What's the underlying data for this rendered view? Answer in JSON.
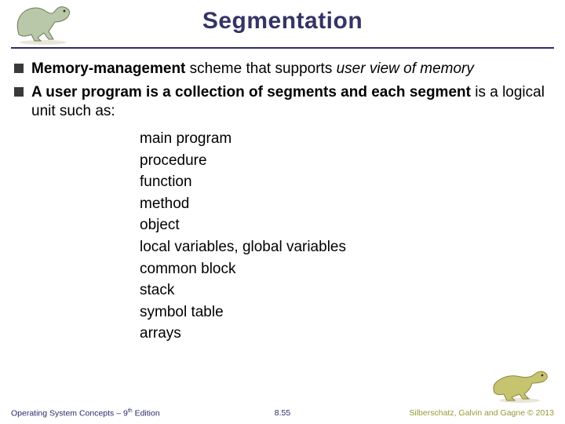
{
  "header": {
    "title": "Segmentation"
  },
  "bullets": [
    {
      "bold_lead": "Memory-management",
      "plain": " scheme that supports ",
      "italic": "user view of memory",
      "tail": ""
    },
    {
      "bold_lead": "A user program is a collection of segments and each segment",
      "plain": " is a logical unit such as:",
      "italic": "",
      "tail": ""
    }
  ],
  "sublist": [
    "main program",
    "procedure",
    "function",
    "method",
    "object",
    "local variables, global variables",
    "common block",
    "stack",
    "symbol table",
    "arrays"
  ],
  "footer": {
    "left_a": "Operating System Concepts – 9",
    "left_sup": "th",
    "left_b": " Edition",
    "center": "8.55",
    "right": "Silberschatz, Galvin and Gagne © 2013"
  },
  "icons": {
    "dino_tl": "dinosaur-running",
    "dino_br": "dinosaur-standing"
  }
}
